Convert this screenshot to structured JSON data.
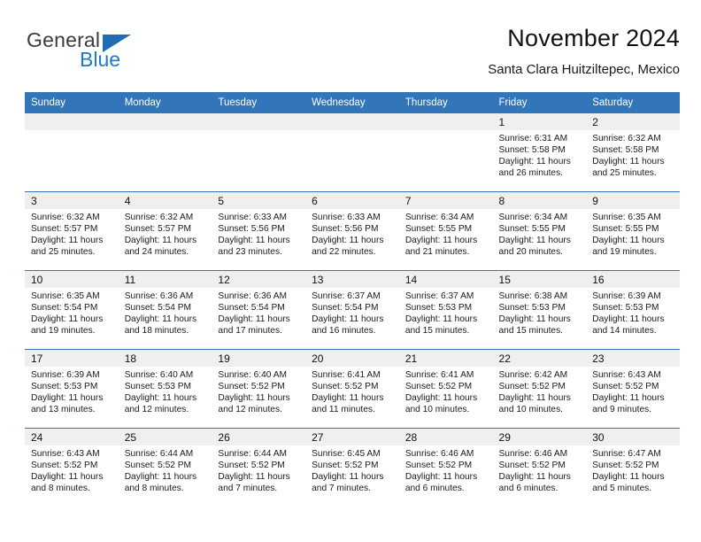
{
  "brand": {
    "general": "General",
    "blue": "Blue",
    "accent_color": "#1f7ac4"
  },
  "header": {
    "title": "November 2024",
    "subtitle": "Santa Clara Huitziltepec, Mexico"
  },
  "calendar": {
    "header_color": "#3275b8",
    "weekdays": [
      "Sunday",
      "Monday",
      "Tuesday",
      "Wednesday",
      "Thursday",
      "Friday",
      "Saturday"
    ],
    "labels": {
      "sunrise": "Sunrise:",
      "sunset": "Sunset:",
      "daylight": "Daylight:"
    },
    "weeks": [
      [
        {
          "day": "",
          "empty": true
        },
        {
          "day": "",
          "empty": true
        },
        {
          "day": "",
          "empty": true
        },
        {
          "day": "",
          "empty": true
        },
        {
          "day": "",
          "empty": true
        },
        {
          "day": "1",
          "sunrise": "Sunrise: 6:31 AM",
          "sunset": "Sunset: 5:58 PM",
          "daylight1": "Daylight: 11 hours",
          "daylight2": "and 26 minutes."
        },
        {
          "day": "2",
          "sunrise": "Sunrise: 6:32 AM",
          "sunset": "Sunset: 5:58 PM",
          "daylight1": "Daylight: 11 hours",
          "daylight2": "and 25 minutes."
        }
      ],
      [
        {
          "day": "3",
          "sunrise": "Sunrise: 6:32 AM",
          "sunset": "Sunset: 5:57 PM",
          "daylight1": "Daylight: 11 hours",
          "daylight2": "and 25 minutes."
        },
        {
          "day": "4",
          "sunrise": "Sunrise: 6:32 AM",
          "sunset": "Sunset: 5:57 PM",
          "daylight1": "Daylight: 11 hours",
          "daylight2": "and 24 minutes."
        },
        {
          "day": "5",
          "sunrise": "Sunrise: 6:33 AM",
          "sunset": "Sunset: 5:56 PM",
          "daylight1": "Daylight: 11 hours",
          "daylight2": "and 23 minutes."
        },
        {
          "day": "6",
          "sunrise": "Sunrise: 6:33 AM",
          "sunset": "Sunset: 5:56 PM",
          "daylight1": "Daylight: 11 hours",
          "daylight2": "and 22 minutes."
        },
        {
          "day": "7",
          "sunrise": "Sunrise: 6:34 AM",
          "sunset": "Sunset: 5:55 PM",
          "daylight1": "Daylight: 11 hours",
          "daylight2": "and 21 minutes."
        },
        {
          "day": "8",
          "sunrise": "Sunrise: 6:34 AM",
          "sunset": "Sunset: 5:55 PM",
          "daylight1": "Daylight: 11 hours",
          "daylight2": "and 20 minutes."
        },
        {
          "day": "9",
          "sunrise": "Sunrise: 6:35 AM",
          "sunset": "Sunset: 5:55 PM",
          "daylight1": "Daylight: 11 hours",
          "daylight2": "and 19 minutes."
        }
      ],
      [
        {
          "day": "10",
          "sunrise": "Sunrise: 6:35 AM",
          "sunset": "Sunset: 5:54 PM",
          "daylight1": "Daylight: 11 hours",
          "daylight2": "and 19 minutes."
        },
        {
          "day": "11",
          "sunrise": "Sunrise: 6:36 AM",
          "sunset": "Sunset: 5:54 PM",
          "daylight1": "Daylight: 11 hours",
          "daylight2": "and 18 minutes."
        },
        {
          "day": "12",
          "sunrise": "Sunrise: 6:36 AM",
          "sunset": "Sunset: 5:54 PM",
          "daylight1": "Daylight: 11 hours",
          "daylight2": "and 17 minutes."
        },
        {
          "day": "13",
          "sunrise": "Sunrise: 6:37 AM",
          "sunset": "Sunset: 5:54 PM",
          "daylight1": "Daylight: 11 hours",
          "daylight2": "and 16 minutes."
        },
        {
          "day": "14",
          "sunrise": "Sunrise: 6:37 AM",
          "sunset": "Sunset: 5:53 PM",
          "daylight1": "Daylight: 11 hours",
          "daylight2": "and 15 minutes."
        },
        {
          "day": "15",
          "sunrise": "Sunrise: 6:38 AM",
          "sunset": "Sunset: 5:53 PM",
          "daylight1": "Daylight: 11 hours",
          "daylight2": "and 15 minutes."
        },
        {
          "day": "16",
          "sunrise": "Sunrise: 6:39 AM",
          "sunset": "Sunset: 5:53 PM",
          "daylight1": "Daylight: 11 hours",
          "daylight2": "and 14 minutes."
        }
      ],
      [
        {
          "day": "17",
          "sunrise": "Sunrise: 6:39 AM",
          "sunset": "Sunset: 5:53 PM",
          "daylight1": "Daylight: 11 hours",
          "daylight2": "and 13 minutes."
        },
        {
          "day": "18",
          "sunrise": "Sunrise: 6:40 AM",
          "sunset": "Sunset: 5:53 PM",
          "daylight1": "Daylight: 11 hours",
          "daylight2": "and 12 minutes."
        },
        {
          "day": "19",
          "sunrise": "Sunrise: 6:40 AM",
          "sunset": "Sunset: 5:52 PM",
          "daylight1": "Daylight: 11 hours",
          "daylight2": "and 12 minutes."
        },
        {
          "day": "20",
          "sunrise": "Sunrise: 6:41 AM",
          "sunset": "Sunset: 5:52 PM",
          "daylight1": "Daylight: 11 hours",
          "daylight2": "and 11 minutes."
        },
        {
          "day": "21",
          "sunrise": "Sunrise: 6:41 AM",
          "sunset": "Sunset: 5:52 PM",
          "daylight1": "Daylight: 11 hours",
          "daylight2": "and 10 minutes."
        },
        {
          "day": "22",
          "sunrise": "Sunrise: 6:42 AM",
          "sunset": "Sunset: 5:52 PM",
          "daylight1": "Daylight: 11 hours",
          "daylight2": "and 10 minutes."
        },
        {
          "day": "23",
          "sunrise": "Sunrise: 6:43 AM",
          "sunset": "Sunset: 5:52 PM",
          "daylight1": "Daylight: 11 hours",
          "daylight2": "and 9 minutes."
        }
      ],
      [
        {
          "day": "24",
          "sunrise": "Sunrise: 6:43 AM",
          "sunset": "Sunset: 5:52 PM",
          "daylight1": "Daylight: 11 hours",
          "daylight2": "and 8 minutes."
        },
        {
          "day": "25",
          "sunrise": "Sunrise: 6:44 AM",
          "sunset": "Sunset: 5:52 PM",
          "daylight1": "Daylight: 11 hours",
          "daylight2": "and 8 minutes."
        },
        {
          "day": "26",
          "sunrise": "Sunrise: 6:44 AM",
          "sunset": "Sunset: 5:52 PM",
          "daylight1": "Daylight: 11 hours",
          "daylight2": "and 7 minutes."
        },
        {
          "day": "27",
          "sunrise": "Sunrise: 6:45 AM",
          "sunset": "Sunset: 5:52 PM",
          "daylight1": "Daylight: 11 hours",
          "daylight2": "and 7 minutes."
        },
        {
          "day": "28",
          "sunrise": "Sunrise: 6:46 AM",
          "sunset": "Sunset: 5:52 PM",
          "daylight1": "Daylight: 11 hours",
          "daylight2": "and 6 minutes."
        },
        {
          "day": "29",
          "sunrise": "Sunrise: 6:46 AM",
          "sunset": "Sunset: 5:52 PM",
          "daylight1": "Daylight: 11 hours",
          "daylight2": "and 6 minutes."
        },
        {
          "day": "30",
          "sunrise": "Sunrise: 6:47 AM",
          "sunset": "Sunset: 5:52 PM",
          "daylight1": "Daylight: 11 hours",
          "daylight2": "and 5 minutes."
        }
      ]
    ]
  }
}
